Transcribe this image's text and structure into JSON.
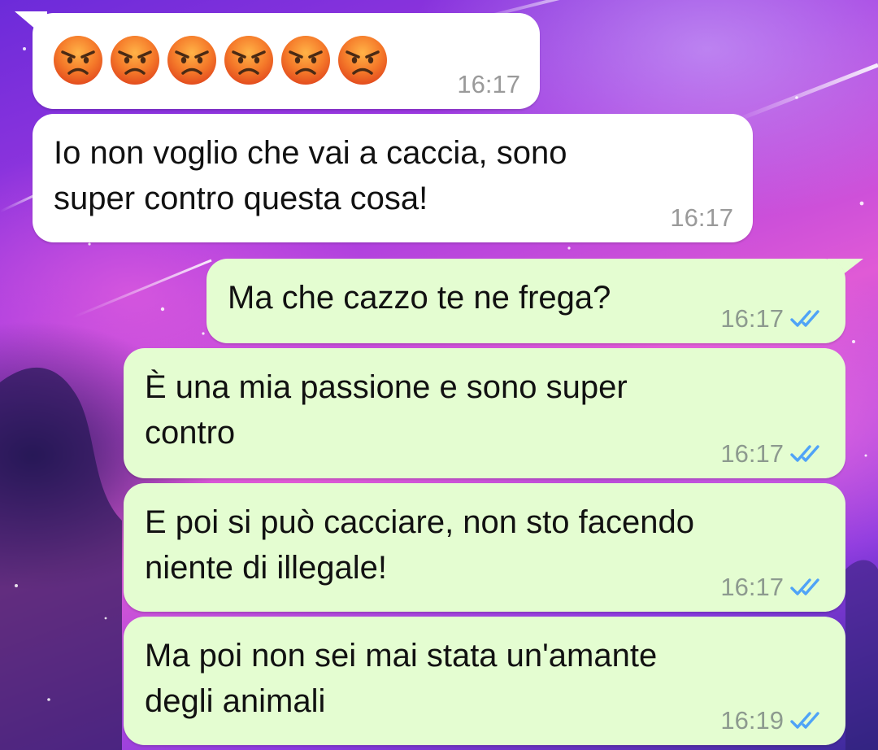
{
  "messages": [
    {
      "id": "m1",
      "direction": "incoming",
      "emoji_count": 6,
      "emoji": "angry-face",
      "time": "16:17"
    },
    {
      "id": "m2",
      "direction": "incoming",
      "text": "Io non voglio che vai a caccia, sono\nsuper contro questa cosa!",
      "time": "16:17"
    },
    {
      "id": "m3",
      "direction": "outgoing",
      "text": "Ma che cazzo te ne frega?",
      "time": "16:17",
      "status": "read"
    },
    {
      "id": "m4",
      "direction": "outgoing",
      "text": "È una mia passione e sono super\ncontro",
      "time": "16:17",
      "status": "read"
    },
    {
      "id": "m5",
      "direction": "outgoing",
      "text": "E poi si può cacciare, non sto facendo\nniente di illegale!",
      "time": "16:17",
      "status": "read"
    },
    {
      "id": "m6",
      "direction": "outgoing",
      "text": "Ma poi non sei mai stata un'amante\ndegli animali",
      "time": "16:19",
      "status": "read"
    }
  ],
  "colors": {
    "incoming_bubble": "#ffffff",
    "outgoing_bubble": "#e4fdd1",
    "read_ticks": "#4fa3f7",
    "timestamp": "#8d9a8f"
  }
}
